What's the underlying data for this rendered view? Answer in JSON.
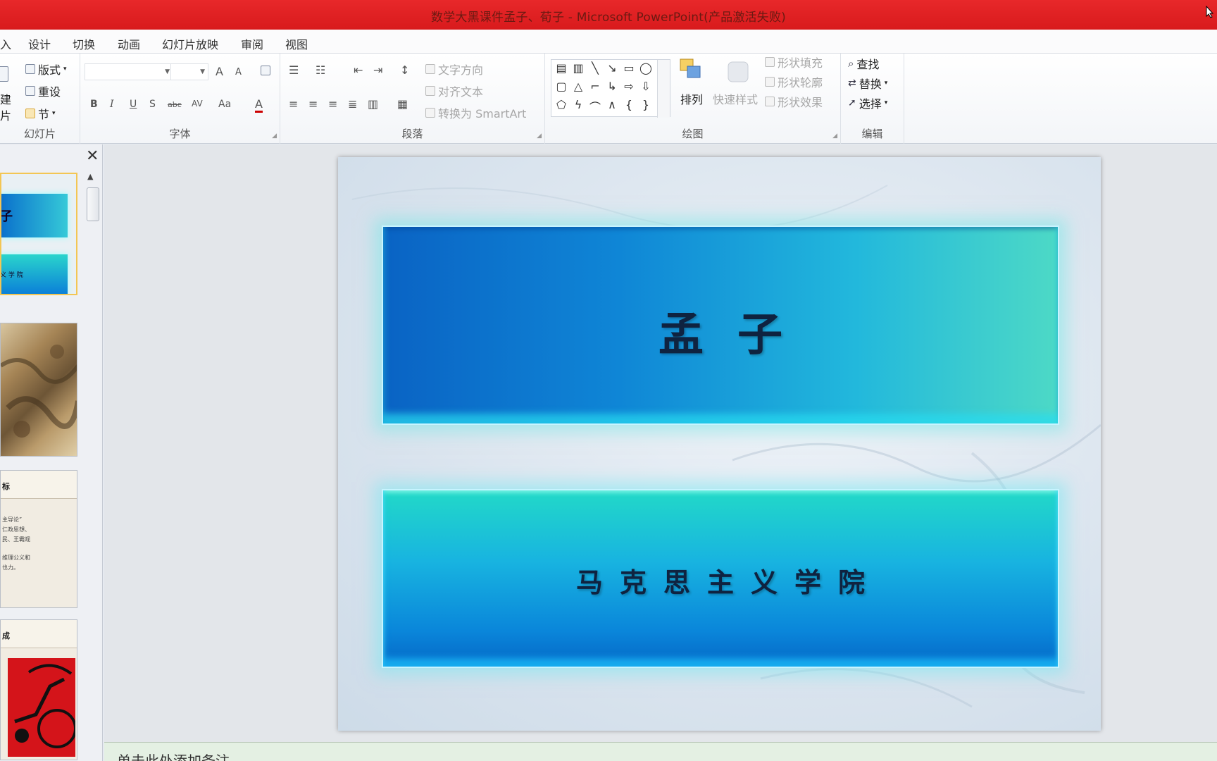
{
  "window": {
    "title": "数学大黑课件孟子、荀子 - Microsoft PowerPoint(产品激活失败)"
  },
  "ribbon_tabs": [
    "入",
    "设计",
    "切换",
    "动画",
    "幻灯片放映",
    "审阅",
    "视图"
  ],
  "ribbon": {
    "slides_group": {
      "label": "幻灯片",
      "layout": "版式",
      "reset": "重设",
      "section": "节",
      "new_slide_line1": "建",
      "new_slide_line2": "片"
    },
    "font_group": {
      "label": "字体",
      "grow": "A",
      "shrink": "A",
      "bold": "B",
      "italic": "I",
      "underline": "U",
      "strike": "S",
      "abc": "abc",
      "spacing": "AV",
      "case": "Aa",
      "color": "A"
    },
    "paragraph_group": {
      "label": "段落",
      "text_direction": "文字方向",
      "align_text": "对齐文本",
      "smartart": "转换为 SmartArt"
    },
    "drawing_group": {
      "label": "绘图",
      "arrange": "排列",
      "quick_styles": "快速样式",
      "shape_fill": "形状填充",
      "shape_outline": "形状轮廓",
      "shape_effects": "形状效果"
    },
    "editing_group": {
      "label": "编辑",
      "find": "查找",
      "replace": "替换",
      "select": "选择"
    }
  },
  "thumbnails": {
    "thumb1_top": "子",
    "thumb1_bottom": "义 学 院",
    "thumb3_header": "标",
    "thumb3_line1": "主导论”",
    "thumb3_line2": "仁政思想、",
    "thumb3_line3": "民、王霸观",
    "thumb3_line4": "维理公义和",
    "thumb3_line5": "也力。",
    "thumb4_header": "成"
  },
  "slide": {
    "title": "孟子",
    "subtitle": "马克思主义学院"
  },
  "notes": {
    "placeholder": "单击此处添加备注"
  },
  "colors": {
    "titlebar": "#e02022",
    "panel_blue": "#0a63c4",
    "panel_cyan": "#22d9c8",
    "selected_thumb_border": "#f3c654"
  }
}
